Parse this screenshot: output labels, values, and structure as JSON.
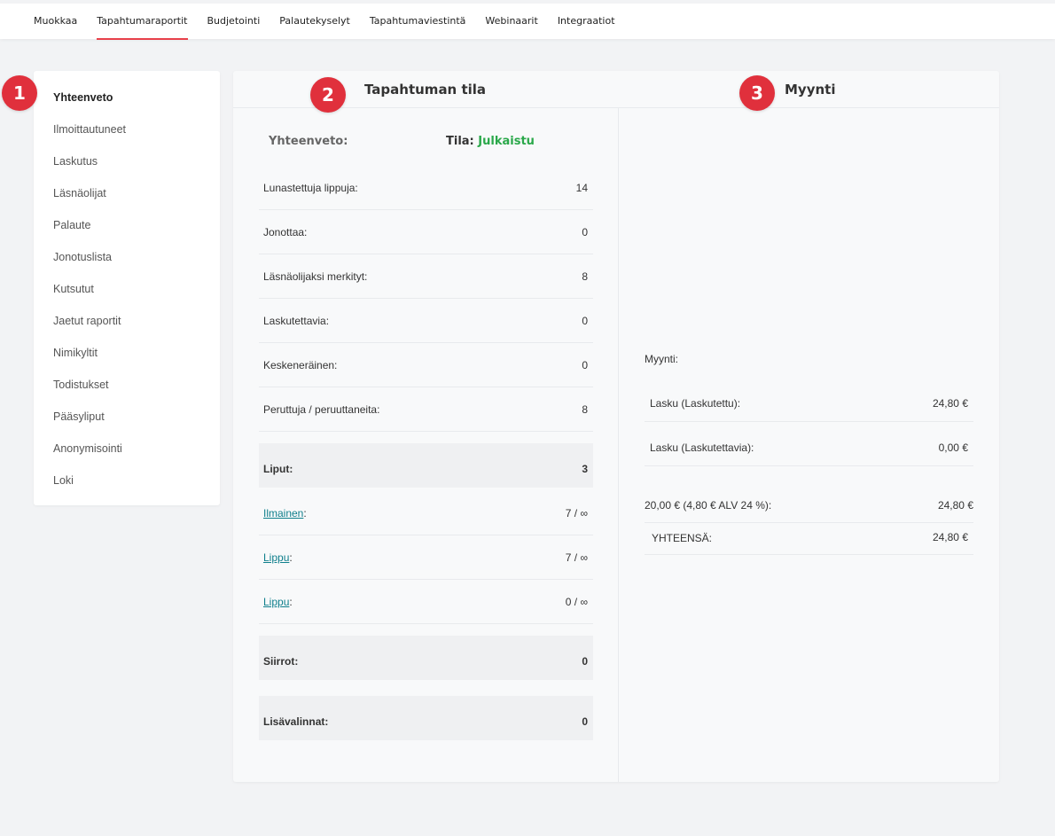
{
  "topnav": {
    "tabs": [
      "Muokkaa",
      "Tapahtumaraportit",
      "Budjetointi",
      "Palautekyselyt",
      "Tapahtumaviestintä",
      "Webinaarit",
      "Integraatiot"
    ],
    "active_index": 1
  },
  "badges": [
    "1",
    "2",
    "3"
  ],
  "sidebar": {
    "items": [
      "Yhteenveto",
      "Ilmoittautuneet",
      "Laskutus",
      "Läsnäolijat",
      "Palaute",
      "Jonotuslista",
      "Kutsutut",
      "Jaetut raportit",
      "Nimikyltit",
      "Todistukset",
      "Pääsyliput",
      "Anonymisointi",
      "Loki"
    ],
    "active_index": 0
  },
  "status_panel": {
    "title": "Tapahtuman tila",
    "summary_label": "Yhteenveto:",
    "status_label": "Tila:",
    "status_value": "Julkaistu",
    "rows": [
      {
        "label": "Lunastettuja lippuja:",
        "value": "14"
      },
      {
        "label": "Jonottaa:",
        "value": "0"
      },
      {
        "label": "Läsnäolijaksi merkityt:",
        "value": "8"
      },
      {
        "label": "Laskutettavia:",
        "value": "0"
      },
      {
        "label": "Keskeneräinen:",
        "value": "0"
      },
      {
        "label": "Peruttuja / peruuttaneita:",
        "value": "8"
      }
    ],
    "tickets_label": "Liput:",
    "tickets_value": "3",
    "ticket_rows": [
      {
        "name": "Ilmainen",
        "value": "7 / ∞"
      },
      {
        "name": "Lippu",
        "value": "7 / ∞"
      },
      {
        "name": "Lippu",
        "value": "0 / ∞"
      }
    ],
    "transfers_label": "Siirrot:",
    "transfers_value": "0",
    "extras_label": "Lisävalinnat:",
    "extras_value": "0"
  },
  "sales_panel": {
    "title": "Myynti",
    "label": "Myynti:",
    "rows": [
      {
        "label": "Lasku (Laskutettu):",
        "value": "24,80 €"
      },
      {
        "label": "Lasku (Laskutettavia):",
        "value": "0,00 €"
      }
    ],
    "vat_label": "20,00 € (4,80 € ALV 24 %):",
    "vat_value": "24,80 €",
    "total_label": "YHTEENSÄ:",
    "total_value": "24,80 €"
  },
  "colors": {
    "accent": "#e0303c",
    "status_green": "#2aa84a",
    "link": "#0f7f8c"
  }
}
